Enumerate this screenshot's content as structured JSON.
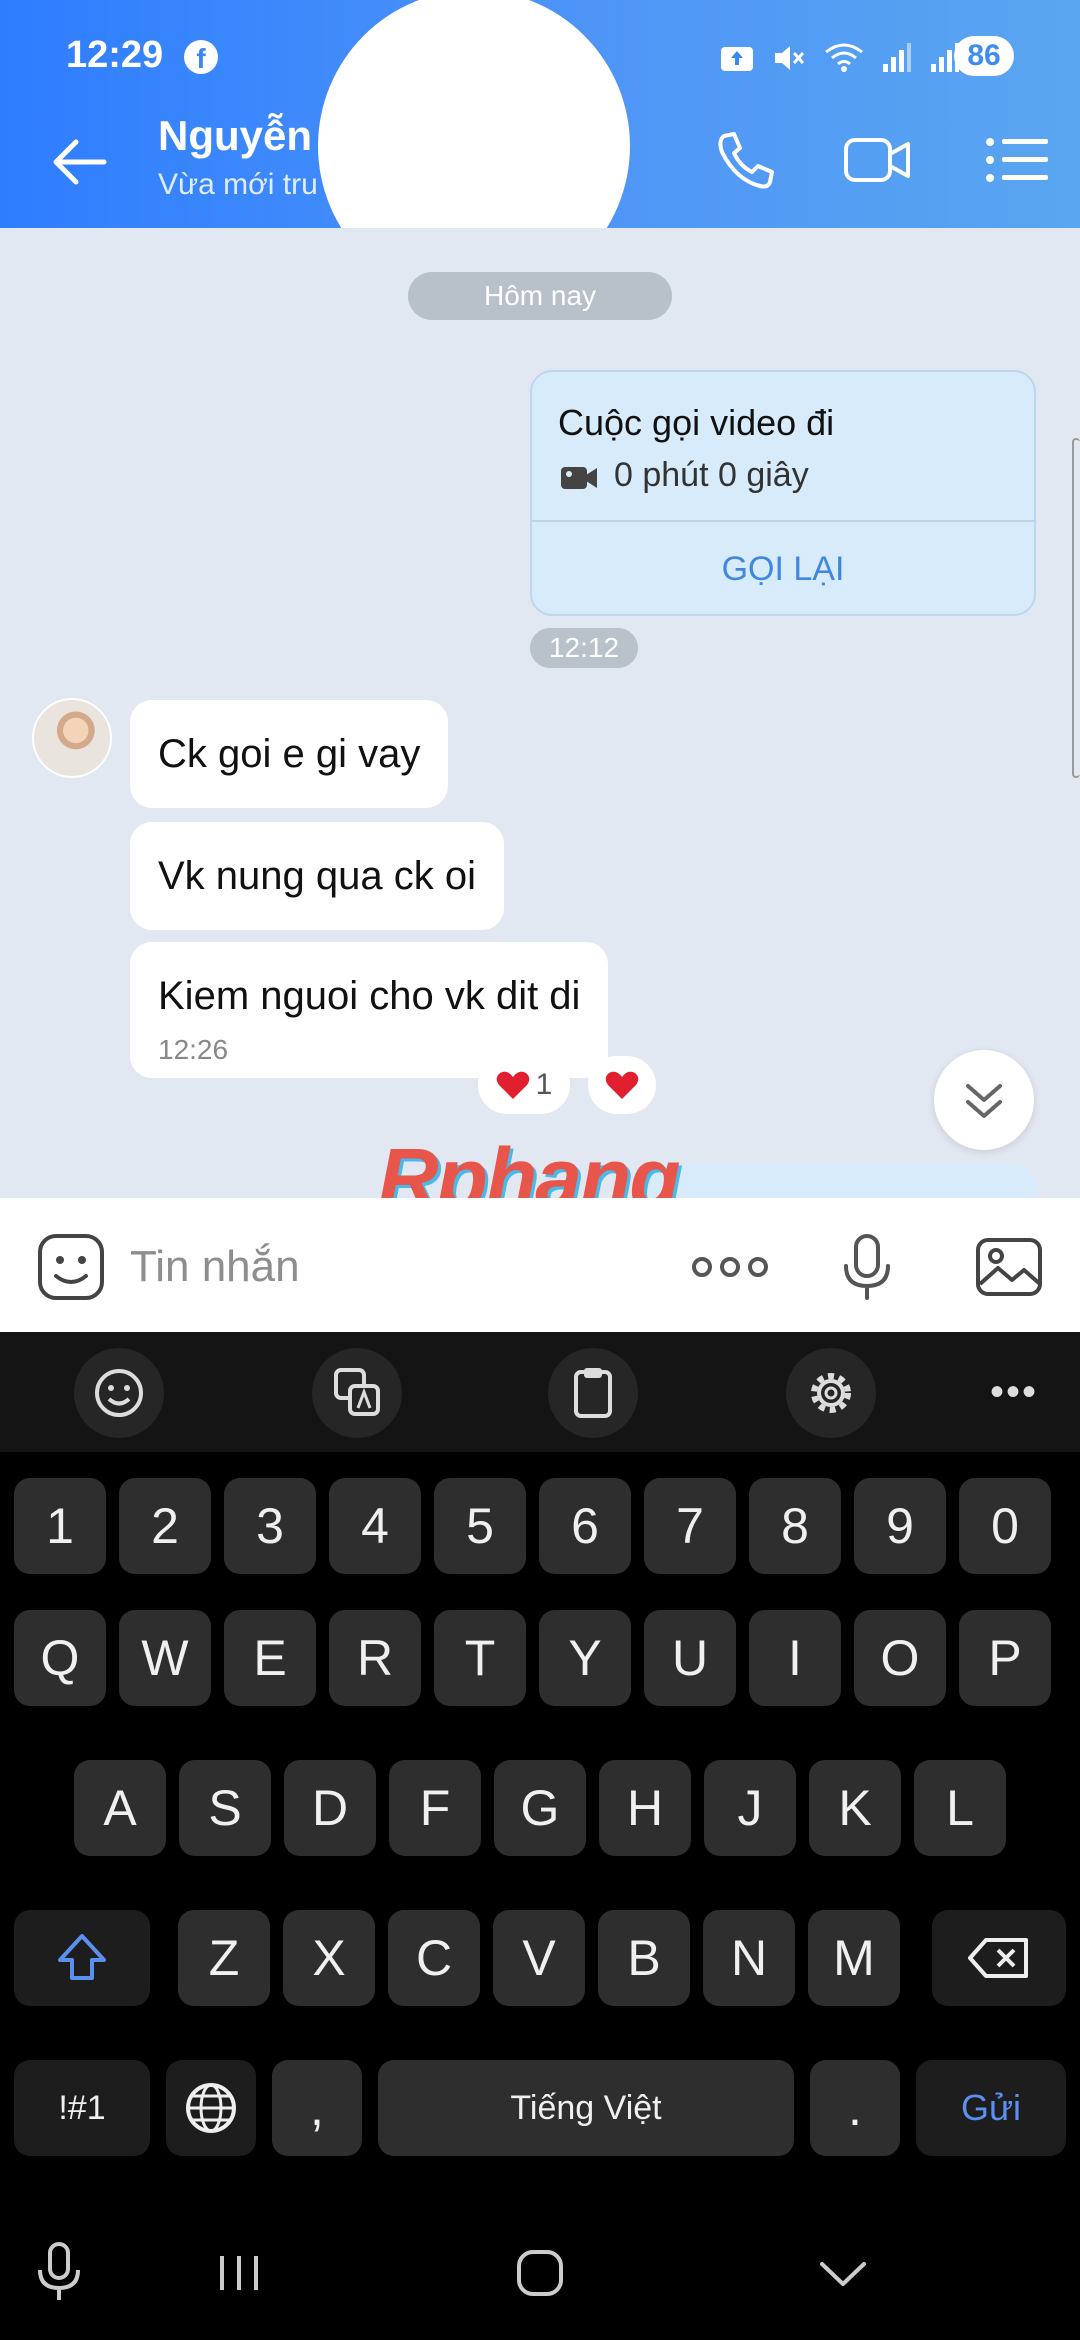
{
  "status_bar": {
    "time": "12:29",
    "facebook_icon": "f",
    "battery": "86",
    "icons": [
      "upload-icon",
      "mute-icon",
      "wifi-icon",
      "signal-icon",
      "signal-icon"
    ]
  },
  "header": {
    "name": "Nguyễn",
    "subtitle": "Vừa mới tru",
    "buttons": [
      "back-icon",
      "phone-icon",
      "video-icon",
      "menu-icon"
    ]
  },
  "chat": {
    "date_separator": "Hôm nay",
    "call_card": {
      "title": "Cuộc gọi video đi",
      "duration": "0 phút 0 giây",
      "action": "GỌI LẠI"
    },
    "call_time": "12:12",
    "messages": [
      {
        "text": "Ck goi e gi vay"
      },
      {
        "text": "Vk nung qua ck oi"
      },
      {
        "text": "Kiem nguoi cho vk dit di",
        "time": "12:26"
      }
    ],
    "reactions": [
      {
        "emoji": "heart",
        "count": "1"
      },
      {
        "emoji": "heart",
        "count": ""
      }
    ],
    "watermark": "Rphang"
  },
  "composer": {
    "placeholder": "Tin nhắn",
    "icons": [
      "sticker-icon",
      "more-icon",
      "mic-icon",
      "image-icon"
    ]
  },
  "keyboard": {
    "toolbar": [
      "emoji-icon",
      "translate-icon",
      "clipboard-icon",
      "settings-icon",
      "more-icon"
    ],
    "row_numbers": [
      "1",
      "2",
      "3",
      "4",
      "5",
      "6",
      "7",
      "8",
      "9",
      "0"
    ],
    "row_top": [
      "Q",
      "W",
      "E",
      "R",
      "T",
      "Y",
      "U",
      "I",
      "O",
      "P"
    ],
    "row_mid": [
      "A",
      "S",
      "D",
      "F",
      "G",
      "H",
      "J",
      "K",
      "L"
    ],
    "row_bottom": [
      "Z",
      "X",
      "C",
      "V",
      "B",
      "N",
      "M"
    ],
    "symbols_key": "!#1",
    "comma_key": ",",
    "space_key": "Tiếng Việt",
    "period_key": ".",
    "send_key": "Gửi"
  },
  "colors": {
    "header_start": "#2e7dff",
    "header_end": "#5aa6f0",
    "chat_background": "#e2e8f1",
    "call_card": "#d7ebfb",
    "accent_blue": "#3f87e0",
    "heart": "#e0202e"
  }
}
